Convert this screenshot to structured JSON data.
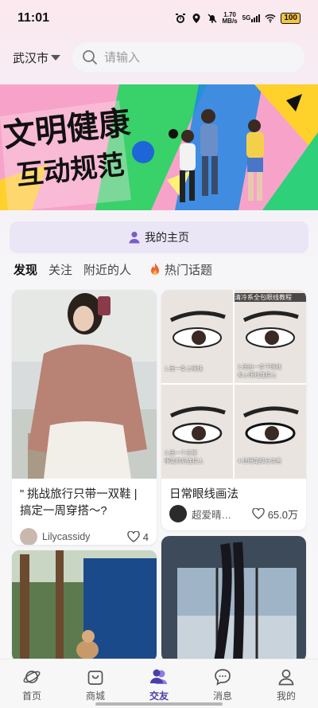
{
  "status": {
    "time": "11:01",
    "speed_value": "1.70",
    "speed_unit": "MB/s",
    "network": "5G",
    "battery": "100"
  },
  "header": {
    "city": "武汉市",
    "search_placeholder": "请输入"
  },
  "banner": {
    "line1": "文明健康",
    "line2": "互动规范"
  },
  "my_home": {
    "label": "我的主页"
  },
  "tabs": [
    {
      "label": "发现",
      "active": true
    },
    {
      "label": "关注"
    },
    {
      "label": "附近的人"
    }
  ],
  "hot_topic": {
    "label": "热门话题",
    "icon": "flame-icon"
  },
  "feed": {
    "cards": [
      {
        "caption": "\" 挑战旅行只带一双鞋 | 搞定一周穿搭～?",
        "author": "Lilycassidy",
        "likes": "4"
      },
      {
        "caption": "日常眼线画法",
        "author": "超爱晴…",
        "likes": "65.0万",
        "image_title": "清冷系全包眼线教程",
        "steps": [
          "1.画一条上眼线",
          "2.画出一条下眼线\n和上眼线连接上",
          "3.画一个正常\n眼尾然后连接上",
          "4.往眼尾部分涂黑"
        ]
      }
    ]
  },
  "bottom_nav": [
    {
      "label": "首页",
      "icon": "planet-icon"
    },
    {
      "label": "商城",
      "icon": "shopping-bag-icon"
    },
    {
      "label": "交友",
      "icon": "people-icon",
      "active": true
    },
    {
      "label": "消息",
      "icon": "chat-bubble-icon"
    },
    {
      "label": "我的",
      "icon": "profile-icon"
    }
  ],
  "colors": {
    "accent": "#4a3fa6",
    "my_home_bg": "#ebe6f6",
    "banner_pink": "#f4a6c8"
  }
}
